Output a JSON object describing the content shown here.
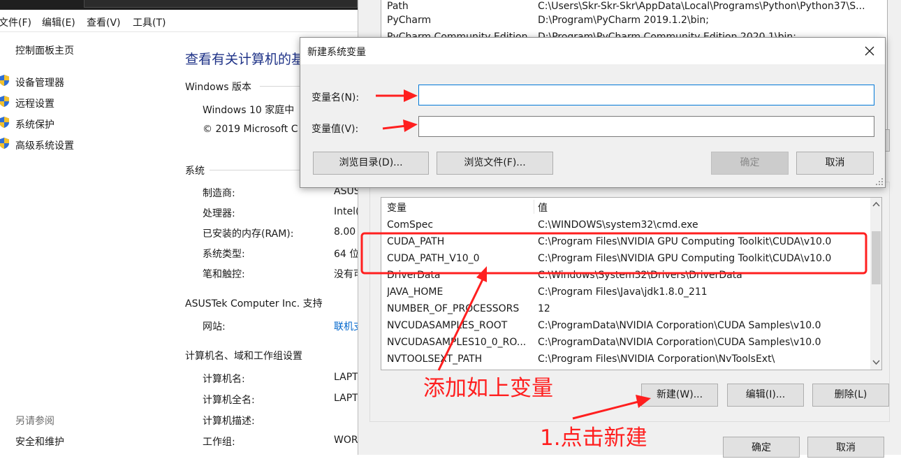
{
  "menubar": [
    "文件(F)",
    "编辑(E)",
    "查看(V)",
    "工具(T)"
  ],
  "leftnav": {
    "home": "控制面板主页",
    "links": [
      "设备管理器",
      "远程设置",
      "系统保护",
      "高级系统设置"
    ],
    "see_also_heading": "另请参阅",
    "see_also": [
      "安全和维护"
    ]
  },
  "system": {
    "title": "查看有关计算机的基",
    "windows_heading": "Windows 版本",
    "windows_edition": "Windows 10 家庭中",
    "copyright": "© 2019 Microsoft C",
    "system_heading": "系统",
    "system_rows": [
      {
        "label": "制造商:",
        "value": "ASUS"
      },
      {
        "label": "处理器:",
        "value": "Intel("
      },
      {
        "label": "已安装的内存(RAM):",
        "value": "8.00"
      },
      {
        "label": "系统类型:",
        "value": "64 位"
      },
      {
        "label": "笔和触控:",
        "value": "没有可"
      }
    ],
    "support_heading": "ASUSTek Computer Inc. 支持",
    "support_rows": [
      {
        "label": "网站:",
        "value": "联机支"
      }
    ],
    "computer_heading": "计算机名、域和工作组设置",
    "computer_rows": [
      {
        "label": "计算机名:",
        "value": "LAPT"
      },
      {
        "label": "计算机全名:",
        "value": "LAPT"
      },
      {
        "label": "计算机描述:",
        "value": ""
      },
      {
        "label": "工作组:",
        "value": "WOR"
      }
    ]
  },
  "envwin": {
    "user_vars": [
      {
        "name": "Path",
        "value": "C:\\Users\\Skr-Skr-Skr\\AppData\\Local\\Programs\\Python\\Python37\\S..."
      },
      {
        "name": "PyCharm",
        "value": "D:\\Program\\PyCharm 2019.1.2\\bin;"
      },
      {
        "name": "PyCharm Community Edition",
        "value": "D:\\Program\\PyCharm Community Edition 2020.1\\bin;"
      }
    ],
    "sys_header": {
      "name": "变量",
      "value": "值"
    },
    "sys_vars": [
      {
        "name": "ComSpec",
        "value": "C:\\WINDOWS\\system32\\cmd.exe"
      },
      {
        "name": "CUDA_PATH",
        "value": "C:\\Program Files\\NVIDIA GPU Computing Toolkit\\CUDA\\v10.0"
      },
      {
        "name": "CUDA_PATH_V10_0",
        "value": "C:\\Program Files\\NVIDIA GPU Computing Toolkit\\CUDA\\v10.0"
      },
      {
        "name": "DriverData",
        "value": "C:\\Windows\\System32\\Drivers\\DriverData"
      },
      {
        "name": "JAVA_HOME",
        "value": "C:\\Program Files\\Java\\jdk1.8.0_211"
      },
      {
        "name": "NUMBER_OF_PROCESSORS",
        "value": "12"
      },
      {
        "name": "NVCUDASAMPLES_ROOT",
        "value": "C:\\ProgramData\\NVIDIA Corporation\\CUDA Samples\\v10.0"
      },
      {
        "name": "NVCUDASAMPLES10_0_RO...",
        "value": "C:\\ProgramData\\NVIDIA Corporation\\CUDA Samples\\v10.0"
      },
      {
        "name": "NVTOOLSEXT_PATH",
        "value": "C:\\Program Files\\NVIDIA Corporation\\NvToolsExt\\"
      }
    ],
    "btn_new": "新建(W)...",
    "btn_edit": "编辑(I)...",
    "btn_delete": "删除(L)",
    "btn_ok": "确定",
    "btn_cancel": "取消"
  },
  "dialog": {
    "title": "新建系统变量",
    "name_label": "变量名(N):",
    "value_label": "变量值(V):",
    "name_value": "",
    "value_value": "",
    "btn_browse_dir": "浏览目录(D)...",
    "btn_browse_file": "浏览文件(F)...",
    "btn_ok": "确定",
    "btn_cancel": "取消"
  },
  "annotations": {
    "add_vars": "添加如上变量",
    "click_new": "1.点击新建"
  },
  "colors": {
    "annotation_red": "#ff1f1f",
    "link_blue": "#0066cc",
    "title_blue": "#1e3287",
    "focus_blue": "#0078d7"
  }
}
